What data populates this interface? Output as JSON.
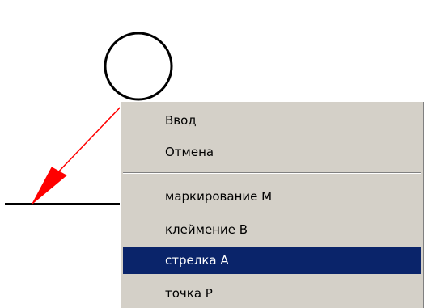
{
  "context_menu": {
    "items": [
      {
        "label": "Ввод"
      },
      {
        "label": "Отмена"
      },
      {
        "label": "маркирование M"
      },
      {
        "label": "клеймение B"
      },
      {
        "label": "стрелка A",
        "selected": true
      },
      {
        "label": "точка P"
      }
    ],
    "selected_index": 4
  },
  "drawing": {
    "arrow_color": "#ff0000",
    "line_color": "#000000"
  },
  "colors": {
    "menu_background": "#d4d0c8",
    "selection_background": "#0a246a",
    "selection_text": "#ffffff"
  }
}
